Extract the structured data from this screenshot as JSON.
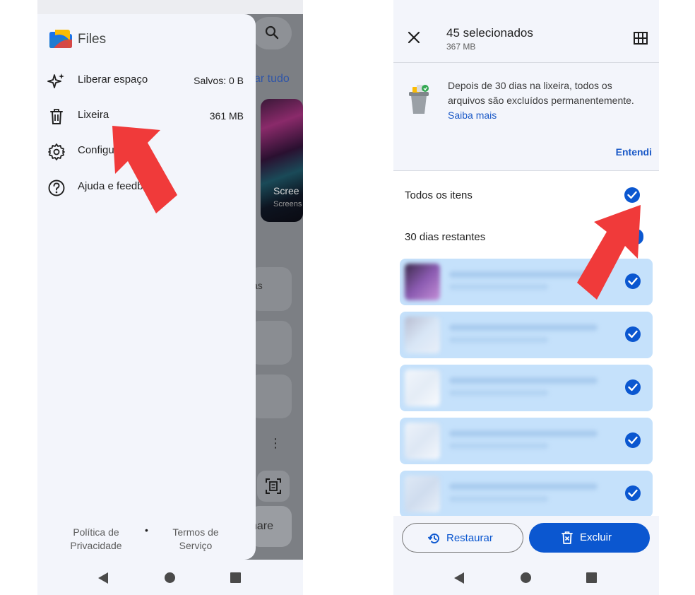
{
  "left_screen": {
    "drawer": {
      "app_title": "Files",
      "items": [
        {
          "icon": "sparkle-icon",
          "label": "Liberar espaço",
          "value": "Salvos: 0 B"
        },
        {
          "icon": "trash-icon",
          "label": "Lixeira",
          "value": "361 MB"
        },
        {
          "icon": "gear-icon",
          "label": "Configurações",
          "value": ""
        },
        {
          "icon": "help-icon",
          "label": "Ajuda e feedback",
          "value": ""
        }
      ],
      "footer": {
        "privacy_line1": "Política de",
        "privacy_line2": "Privacidade",
        "separator": "•",
        "terms_line1": "Termos de",
        "terms_line2": "Serviço"
      }
    },
    "background": {
      "select_all_partial": "ar tudo",
      "card_title_partial": "Scree",
      "card_subtitle_partial": "Screens",
      "row_text_partial": "as",
      "more_icon": "⋮",
      "share_edge_partial": "r",
      "share_partial": "hare"
    }
  },
  "right_screen": {
    "header": {
      "title": "45 selecionados",
      "size": "367 MB"
    },
    "banner": {
      "text": "Depois de 30 dias na lixeira, todos os arquivos são excluídos permanentemente.",
      "link": "Saiba mais",
      "dismiss": "Entendi"
    },
    "sections": [
      {
        "label": "Todos os itens",
        "checked": true
      },
      {
        "label": "30 dias restantes",
        "checked": true
      }
    ],
    "files": [
      {
        "thumb_colors": [
          "#3b2a4a",
          "#8a5ab0",
          "#c58fd8"
        ],
        "checked": true
      },
      {
        "thumb_colors": [
          "#d8e6f6",
          "#c8d8ee",
          "#e8eef8"
        ],
        "checked": true
      },
      {
        "thumb_colors": [
          "#f2f6fb",
          "#e4ecf6",
          "#f8fafd"
        ],
        "checked": true
      },
      {
        "thumb_colors": [
          "#eef3fa",
          "#dde7f4",
          "#f4f7fc"
        ],
        "checked": true
      },
      {
        "thumb_colors": [
          "#dfe9f6",
          "#cfdcee",
          "#e9f0f9"
        ],
        "checked": true
      }
    ],
    "actions": {
      "restore": "Restaurar",
      "delete": "Excluir"
    }
  },
  "colors": {
    "accent": "#0b57d0",
    "arrow": "#f03a3a",
    "selected_bg": "#c5e1fb"
  }
}
